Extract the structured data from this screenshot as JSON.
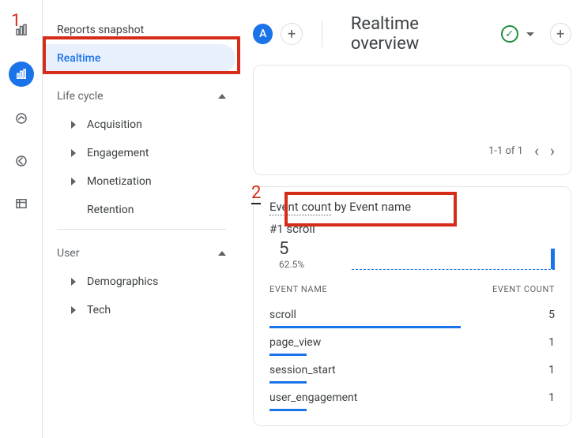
{
  "sidebar": {
    "snapshot_label": "Reports snapshot",
    "realtime_label": "Realtime",
    "section_lifecycle": "Life cycle",
    "items_lifecycle": [
      "Acquisition",
      "Engagement",
      "Monetization",
      "Retention"
    ],
    "section_user": "User",
    "items_user": [
      "Demographics",
      "Tech"
    ]
  },
  "header": {
    "avatar_letter": "A",
    "title": "Realtime overview"
  },
  "pager": {
    "label": "1-1 of 1"
  },
  "card": {
    "title_strong": "Event count",
    "title_rest": " by Event name",
    "rank_prefix": "#1",
    "rank_name": "scroll",
    "big_number": "5",
    "percent": "62.5%",
    "col_left": "EVENT NAME",
    "col_right": "EVENT COUNT",
    "rows": [
      {
        "name": "scroll",
        "count": "5",
        "bar_pct": 67
      },
      {
        "name": "page_view",
        "count": "1",
        "bar_pct": 13
      },
      {
        "name": "session_start",
        "count": "1",
        "bar_pct": 13
      },
      {
        "name": "user_engagement",
        "count": "1",
        "bar_pct": 13
      }
    ]
  },
  "annotations": {
    "n1": "1",
    "n2": "2"
  }
}
